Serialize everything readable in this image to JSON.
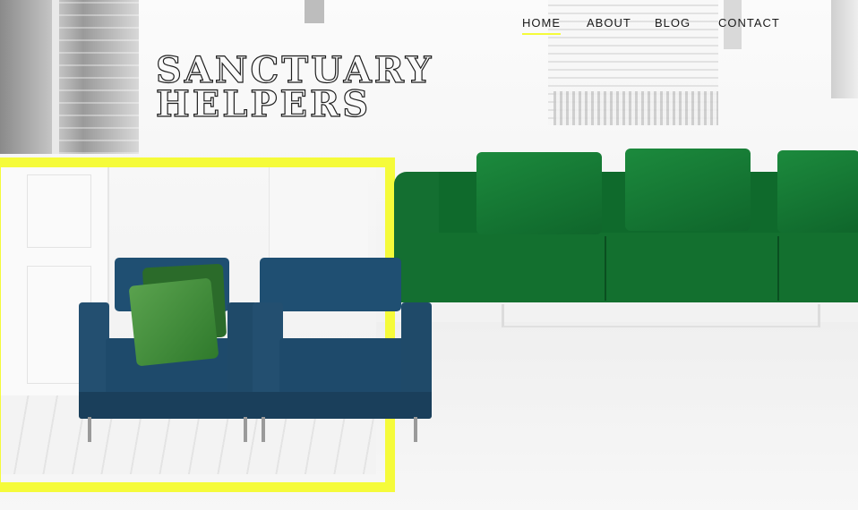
{
  "site": {
    "title_line1": "SANCTUARY",
    "title_line2": "HELPERS"
  },
  "nav": {
    "items": [
      {
        "label": "HOME",
        "active": true
      },
      {
        "label": "ABOUT",
        "active": false
      },
      {
        "label": "BLOG",
        "active": false
      },
      {
        "label": "CONTACT",
        "active": false
      }
    ]
  },
  "colors": {
    "accent": "#f5fb3a",
    "sofa_green": "#13702f",
    "armchair_blue": "#1f4f72"
  }
}
